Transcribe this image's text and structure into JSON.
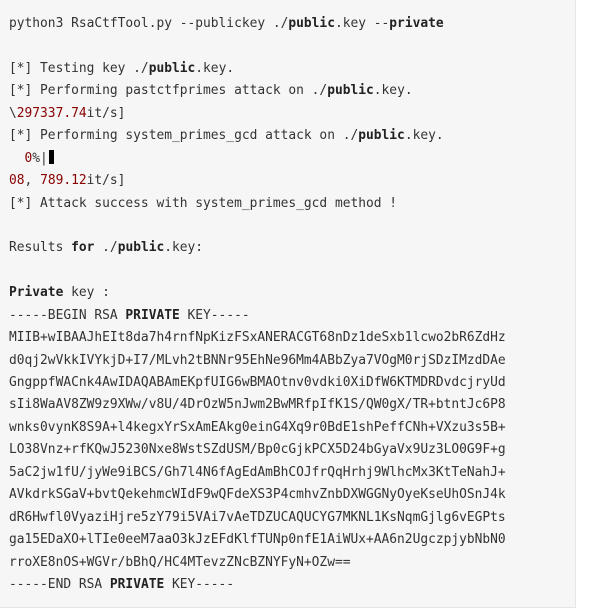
{
  "terminal": {
    "command": {
      "pre": "python3 RsaCtfTool.py --publickey ./",
      "b1": "public",
      "mid": ".key --",
      "b2": "private"
    },
    "testing": {
      "pre": "[*] Testing key ./",
      "b": "public",
      "post": ".key."
    },
    "performing1": {
      "pre": "[*] Performing pastctfprimes attack on ./",
      "b": "public",
      "post": ".key."
    },
    "speed1": {
      "pre": "\\",
      "num": "297337.74",
      "post": "it/s]"
    },
    "performing2": {
      "pre": "[*] Performing system_primes_gcd attack on ./",
      "b": "public",
      "post": ".key."
    },
    "progress": {
      "pre": "  ",
      "num": "0",
      "post": "%|"
    },
    "speed2": {
      "num1": "08",
      "mid": ", ",
      "num2": "789.12",
      "post": "it/s]"
    },
    "success": "[*] Attack success with system_primes_gcd method !",
    "results": {
      "pre": "Results ",
      "kw": "for",
      "mid": " ./",
      "b": "public",
      "post": ".key:"
    },
    "private_label": {
      "b": "Private",
      "post": " key :"
    },
    "begin": {
      "pre": "-----BEGIN RSA ",
      "b": "PRIVATE",
      "post": " KEY-----"
    },
    "key_lines": [
      "MIIB+wIBAAJhEIt8da7h4rnfNpKizFSxANERACGT68nDz1deSxb1lcwo2bR6ZdHz",
      "d0qj2wVkkIVYkjD+I7/MLvh2tBNNr95EhNe96Mm4ABbZya7VOgM0rjSDzIMzdDAe",
      "GngppfWACnk4AwIDAQABAmEKpfUIG6wBMAOtnv0vdki0XiDfW6KTMDRDvdcjryUd",
      "sIi8WaAV8ZW9z9XWw/v8U/4DrOzW5nJwm2BwMRfpIfK1S/QW0gX/TR+btntJc6P8",
      "wnks0vynK8S9A+l4kegxYrSxAmEAkg0einG4Xq9r0BdE1shPeffCNh+VXzu3s5B+",
      "LO38Vnz+rfKQwJ5230Nxe8WstSZdUSM/Bp0cGjkPCX5D24bGyaVx9Uz3LO0G9F+g",
      "5aC2jw1fU/jyWe9iBCS/Gh7l4N6fAgEdAmBhCOJfrQqHrhj9WlhcMx3KtTeNahJ+",
      "AVkdrkSGaV+bvtQekehmcWIdF9wQFdeXS3P4cmhvZnbDXWGGNyOyeKseUhOSnJ4k",
      "dR6Hwfl0VyaziHjre5zY79i5VAi7vAeTDZUCAQUCYG7MKNL1KsNqmGjlg6vEGPts",
      "ga15EDaXO+lTIe0eeM7aaO3kJzEFdKlfTUNp0nfE1AiWUx+AA6n2UgczpjybNbN0",
      "rroXE8nOS+WGVr/bBhQ/HC4MTevzZNcBZNYFyN+OZw=="
    ],
    "end": {
      "pre": "-----END RSA ",
      "b": "PRIVATE",
      "post": " KEY-----"
    }
  }
}
